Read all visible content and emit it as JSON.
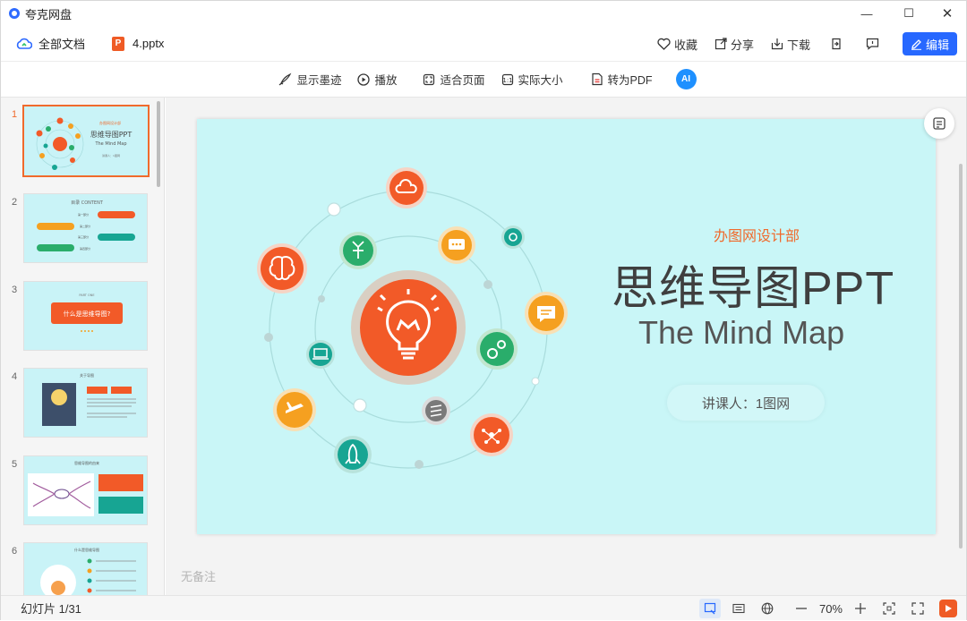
{
  "app": {
    "name": "夸克网盘"
  },
  "window_controls": {
    "minimize": "—",
    "maximize": "☐",
    "close": "✕"
  },
  "topbar": {
    "breadcrumb": "全部文档",
    "file_name": "4.pptx",
    "file_badge": "P",
    "actions": {
      "favorite": "收藏",
      "share": "分享",
      "download": "下载"
    },
    "edit_label": "编辑"
  },
  "toolbar": {
    "show_ink": "显示墨迹",
    "play": "播放",
    "fit_page": "适合页面",
    "actual_size": "实际大小",
    "to_pdf": "转为PDF",
    "ai_label": "AI"
  },
  "thumbnails": [
    {
      "num": "1",
      "title": "思维导图PPT",
      "subtitle": "The Mind Map"
    },
    {
      "num": "2",
      "title": "目录 CONTENT"
    },
    {
      "num": "3",
      "title": "什么是思维导图?"
    },
    {
      "num": "4",
      "title": "关于导图"
    },
    {
      "num": "5",
      "title": "思维导图的由来"
    },
    {
      "num": "6",
      "title": "什么是思维导图"
    }
  ],
  "slide": {
    "org": "办图网设计部",
    "title": "思维导图PPT",
    "subtitle": "The Mind Map",
    "lecturer": "讲课人：1图网"
  },
  "notes_placeholder": "无备注",
  "statusbar": {
    "slide_counter": "幻灯片 1/31",
    "zoom": "70%"
  },
  "colors": {
    "accent": "#2768ff",
    "orange": "#f06a2c",
    "slide_bg": "#c9f6f7",
    "teal": "#17a593",
    "green": "#2aad6b"
  }
}
